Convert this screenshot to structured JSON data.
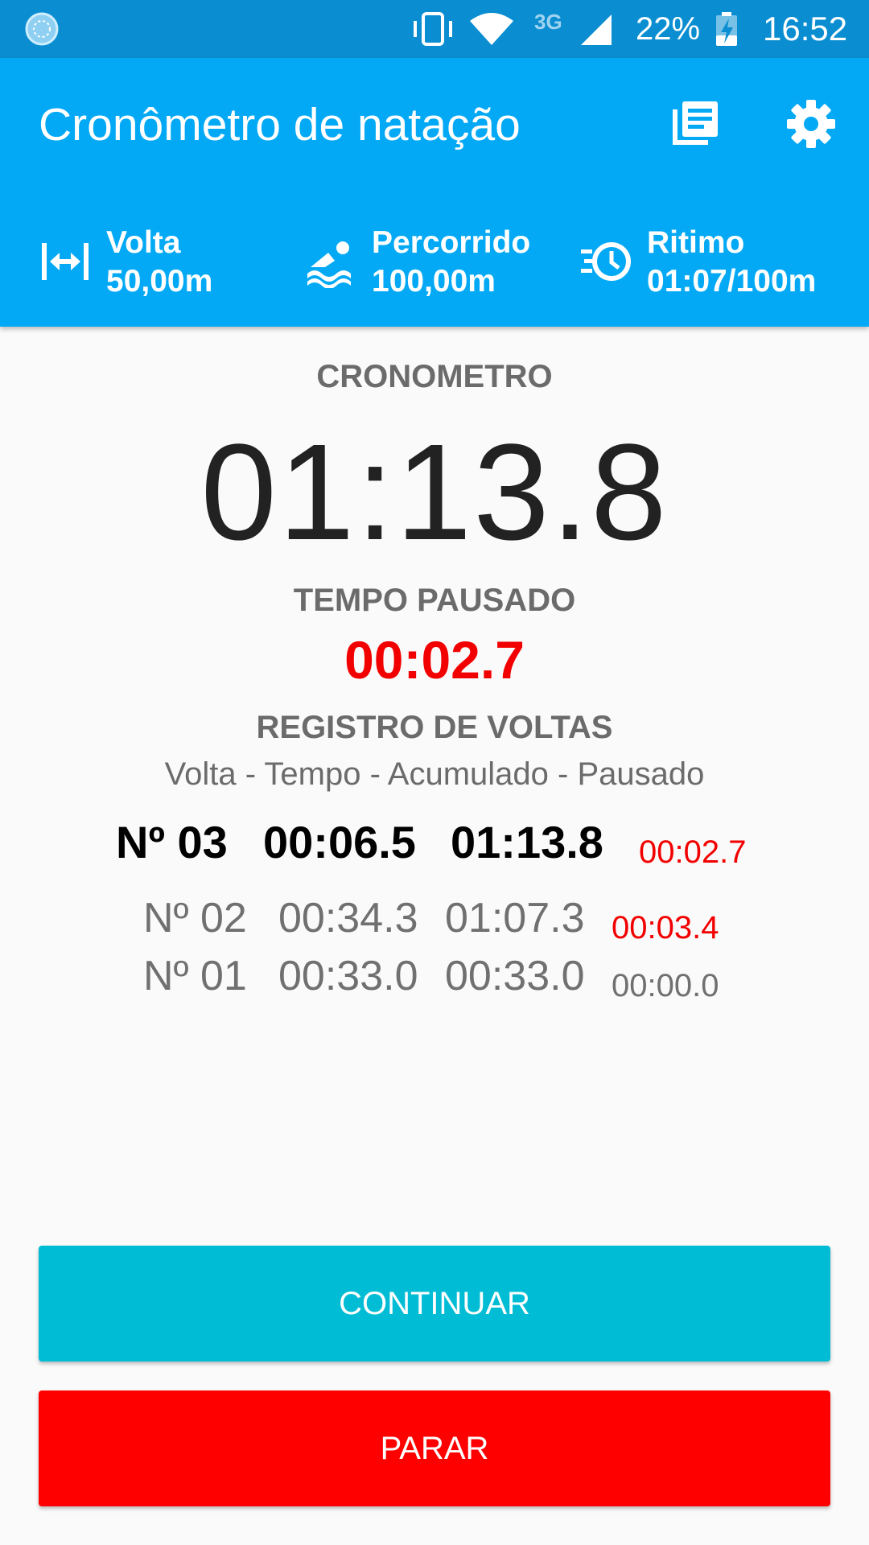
{
  "status_bar": {
    "network_type": "3G",
    "battery_percent": "22%",
    "time": "16:52",
    "icons": [
      "notification-circle-icon",
      "vibrate-icon",
      "wifi-icon",
      "signal-icon",
      "battery-charging-icon"
    ]
  },
  "app_bar": {
    "title": "Cronômetro de natação",
    "actions": [
      "history-icon",
      "settings-icon"
    ]
  },
  "stats": [
    {
      "icon": "lap-length-icon",
      "label": "Volta",
      "value": "50,00m"
    },
    {
      "icon": "swimmer-icon",
      "label": "Percorrido",
      "value": "100,00m"
    },
    {
      "icon": "pace-clock-icon",
      "label": "Ritimo",
      "value": "01:07/100m"
    }
  ],
  "timer": {
    "label": "CRONOMETRO",
    "value": "01:13.8"
  },
  "paused": {
    "label": "TEMPO PAUSADO",
    "value": "00:02.7"
  },
  "laps": {
    "title": "REGISTRO DE VOLTAS",
    "subtitle": "Volta - Tempo - Acumulado - Pausado",
    "rows": [
      {
        "number": "Nº 03",
        "time": "00:06.5",
        "accumulated": "01:13.8",
        "paused": "00:02.7"
      },
      {
        "number": "Nº 02",
        "time": "00:34.3",
        "accumulated": "01:07.3",
        "paused": "00:03.4"
      },
      {
        "number": "Nº 01",
        "time": "00:33.0",
        "accumulated": "00:33.0",
        "paused": "00:00.0"
      }
    ]
  },
  "buttons": {
    "continue_label": "CONTINUAR",
    "stop_label": "PARAR"
  },
  "colors": {
    "status_bar": "#0a8ed1",
    "app_bar": "#03a9f4",
    "paused_red": "#f20000",
    "continue_button": "#00bcd4",
    "stop_button": "#ff0000"
  }
}
